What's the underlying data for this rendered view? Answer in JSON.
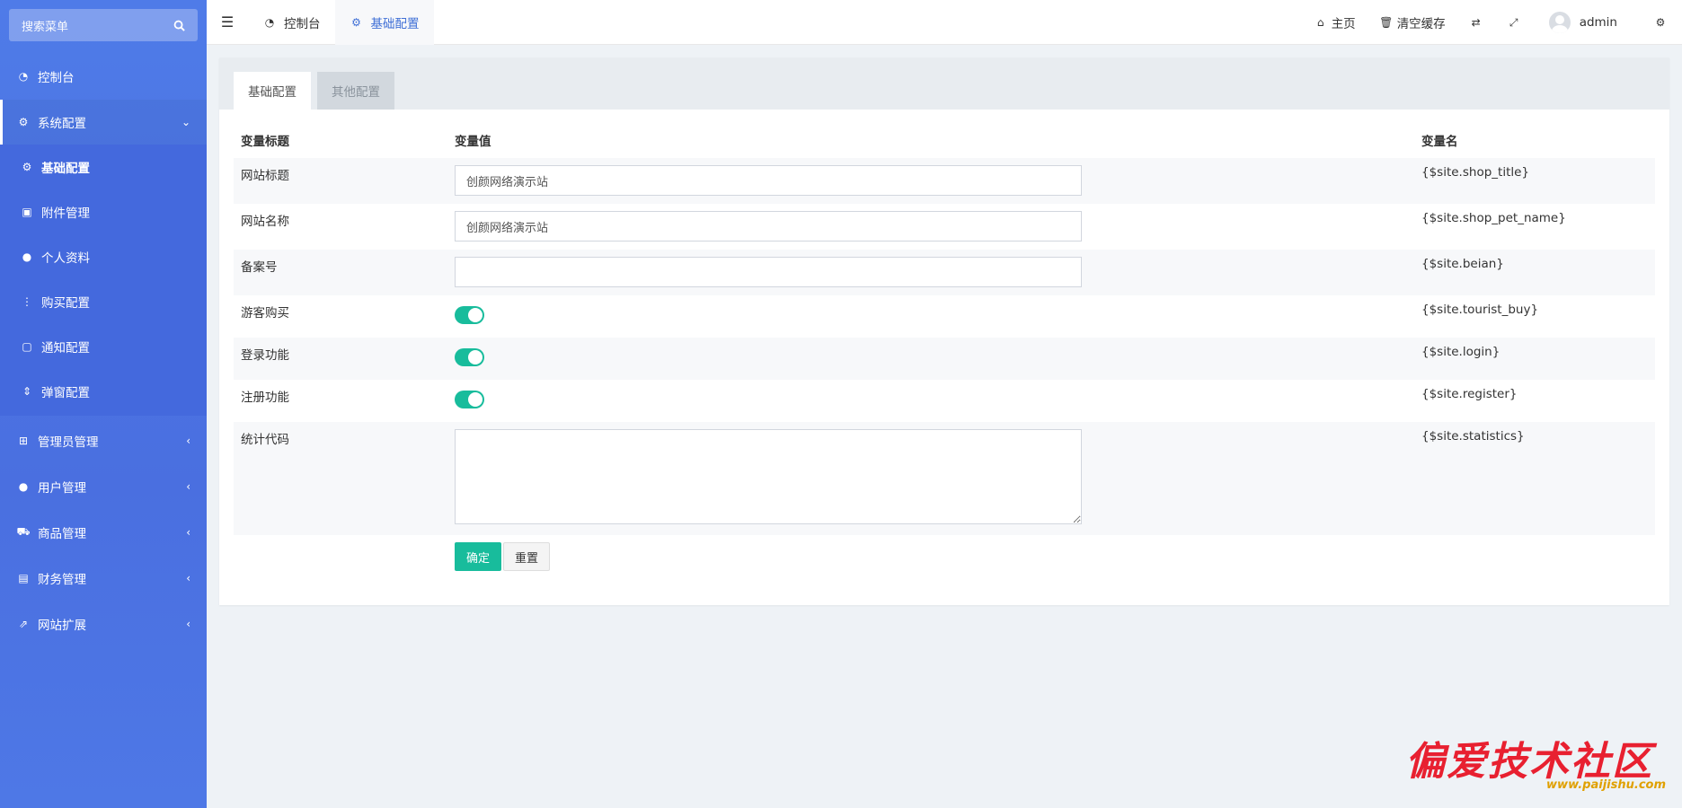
{
  "sidebar": {
    "search_placeholder": "搜索菜单",
    "menu": [
      {
        "label": "控制台",
        "icon": "dashboard-icon"
      },
      {
        "label": "系统配置",
        "icon": "cogs-icon"
      },
      {
        "label": "管理员管理",
        "icon": "windows-icon"
      },
      {
        "label": "用户管理",
        "icon": "user-icon"
      },
      {
        "label": "商品管理",
        "icon": "cart-icon"
      },
      {
        "label": "财务管理",
        "icon": "finance-icon"
      },
      {
        "label": "网站扩展",
        "icon": "external-link-icon"
      }
    ],
    "submenu": [
      {
        "label": "基础配置",
        "icon": "gear-icon"
      },
      {
        "label": "附件管理",
        "icon": "image-icon"
      },
      {
        "label": "个人资料",
        "icon": "user-icon"
      },
      {
        "label": "购买配置",
        "icon": "ellipsis-v-icon"
      },
      {
        "label": "通知配置",
        "icon": "comment-icon"
      },
      {
        "label": "弹窗配置",
        "icon": "sort-icon"
      }
    ]
  },
  "topbar": {
    "tabs": [
      {
        "label": "控制台",
        "icon": "dashboard-icon"
      },
      {
        "label": "基础配置",
        "icon": "gear-icon"
      }
    ],
    "links": {
      "home": "主页",
      "clear_cache": "清空缓存",
      "user": "admin"
    }
  },
  "content": {
    "tabs": [
      "基础配置",
      "其他配置"
    ],
    "columns": {
      "title": "变量标题",
      "value": "变量值",
      "name": "变量名"
    },
    "rows": [
      {
        "title": "网站标题",
        "value": "创颜网络演示站",
        "name": "{$site.shop_title}"
      },
      {
        "title": "网站名称",
        "value": "创颜网络演示站",
        "name": "{$site.shop_pet_name}"
      },
      {
        "title": "备案号",
        "value": "",
        "name": "{$site.beian}"
      },
      {
        "title": "游客购买",
        "value": "on",
        "name": "{$site.tourist_buy}"
      },
      {
        "title": "登录功能",
        "value": "on",
        "name": "{$site.login}"
      },
      {
        "title": "注册功能",
        "value": "on",
        "name": "{$site.register}"
      },
      {
        "title": "统计代码",
        "value": "",
        "name": "{$site.statistics}"
      }
    ],
    "buttons": {
      "submit": "确定",
      "reset": "重置"
    }
  },
  "watermark": {
    "text": "偏爱技术社区",
    "url": "www.paijishu.com"
  },
  "colors": {
    "sidebar": "#4a6fe0",
    "accent": "#18bc9c",
    "active_tab": "#3f6fd6"
  }
}
